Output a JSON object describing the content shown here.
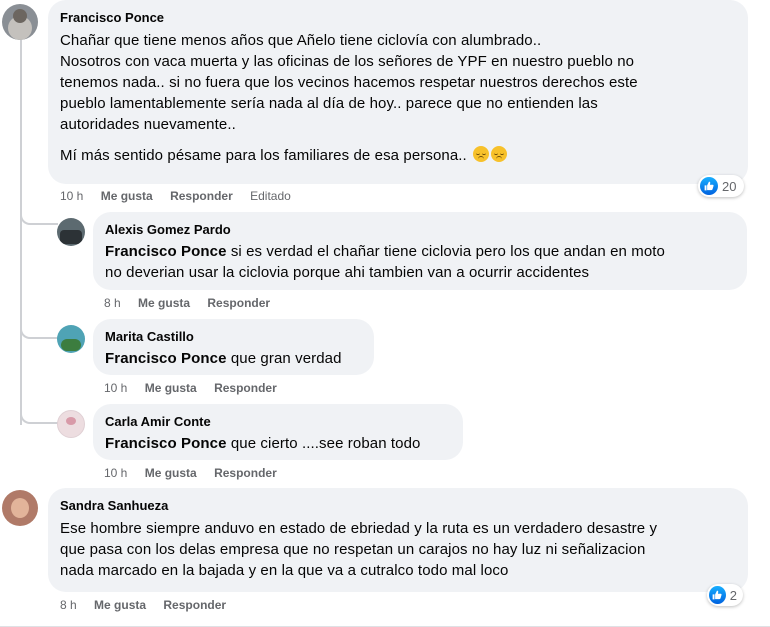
{
  "comments": [
    {
      "author": "Francisco Ponce",
      "lines": [
        "Chañar que tiene menos años que Añelo tiene ciclovía con alumbrado..",
        "Nosotros con vaca muerta y las oficinas de los señores de YPF en nuestro pueblo no",
        "tenemos nada.. si no fuera que los vecinos hacemos respetar nuestros derechos este",
        "pueblo lamentablemente sería nada al día de hoy.. parece que no entienden las",
        "autoridades nuevamente.."
      ],
      "last_line": "Mí más sentido pésame para los familiares de esa persona..",
      "time": "10 h",
      "like_label": "Me gusta",
      "reply_label": "Responder",
      "edited_label": "Editado",
      "reaction_count": "20",
      "avatar_color": "#8a8f95",
      "emoji_name": "disappointed-face"
    },
    {
      "author": "Alexis Gomez Pardo",
      "mention": "Francisco Ponce",
      "line1": " si es verdad el chañar tiene ciclovia pero los que andan en moto",
      "line2": "no deverian usar la ciclovia porque ahi tambien van a ocurrir accidentes",
      "time": "8 h",
      "like_label": "Me gusta",
      "reply_label": "Responder",
      "avatar_color": "#5c6a70"
    },
    {
      "author": "Marita Castillo",
      "mention": "Francisco Ponce",
      "text": " que gran verdad",
      "time": "10 h",
      "like_label": "Me gusta",
      "reply_label": "Responder",
      "avatar_color": "#4fa3b5"
    },
    {
      "author": "Carla Amir Conte",
      "mention": "Francisco Ponce",
      "text": " que cierto ....see roban todo",
      "time": "10 h",
      "like_label": "Me gusta",
      "reply_label": "Responder",
      "avatar_color": "#eddde0"
    },
    {
      "author": "Sandra Sanhueza",
      "lines": [
        "Ese hombre siempre anduvo en estado de ebriedad y la ruta es un verdadero desastre y",
        "que pasa con los delas empresa que no respetan un carajos no hay luz ni señalizacion",
        "nada marcado en la bajada y en la que va a cutralco todo mal loco"
      ],
      "time": "8 h",
      "like_label": "Me gusta",
      "reply_label": "Responder",
      "reaction_count": "2",
      "avatar_color": "#b07a68"
    }
  ]
}
